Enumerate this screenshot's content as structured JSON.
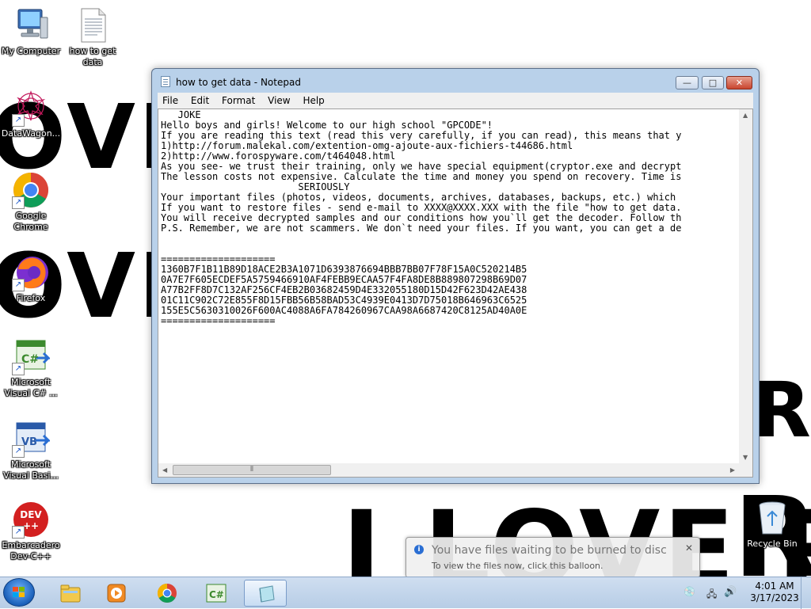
{
  "desktop": {
    "wallpaper_words": [
      "OVE",
      "OVE",
      "I LOVE R",
      "RA",
      "R"
    ],
    "icons": [
      {
        "label": "My Computer"
      },
      {
        "label": "how to get data"
      },
      {
        "label": "DataWagon..."
      },
      {
        "label": "Google Chrome"
      },
      {
        "label": "Firefox"
      },
      {
        "label": "Microsoft Visual C# ..."
      },
      {
        "label": "Microsoft Visual Basi..."
      },
      {
        "label": "Embarcadero Dev-C++"
      },
      {
        "label": "Recycle Bin"
      }
    ],
    "badges": {
      "vcs": "C#",
      "vb": "VB",
      "dev": "DEV",
      "devpp": "++"
    }
  },
  "notepad": {
    "title": "how to get data - Notepad",
    "menu": [
      "File",
      "Edit",
      "Format",
      "View",
      "Help"
    ],
    "caption": {
      "minimize": "—",
      "maximize": "□",
      "close": "✕"
    },
    "content": "   JOKE\nHello boys and girls! Welcome to our high school \"GPCODE\"!\nIf you are reading this text (read this very carefully, if you can read), this means that y\n1)http://forum.malekal.com/extention-omg-ajoute-aux-fichiers-t44686.html\n2)http://www.forospyware.com/t464048.html\nAs you see- we trust their training, only we have special equipment(cryptor.exe and decrypt\nThe lesson costs not expensive. Calculate the time and money you spend on recovery. Time is\n                        SERIOUSLY\nYour important files (photos, videos, documents, archives, databases, backups, etc.) which \nIf you want to restore files - send e-mail to XXXX@XXXX.XXX with the file \"how to get data.\nYou will receive decrypted samples and our conditions how you`ll get the decoder. Follow th\nP.S. Remember, we are not scammers. We don`t need your files. If you want, you can get a de\n\n\n====================\n1360B7F1B11B89D18ACE2B3A1071D6393876694BBB7BB07F78F15A0C520214B5\n0A7E7F605ECDEF5A5759466910AF4FEBB9ECAA57F4FA8DE8B889807298B69D07\nA77B2FF8D7C132AF256CF4EB2B03682459D4E332055180D15D42F623D42AE438\n01C11C902C72E855F8D15FBB56B58BAD53C4939E0413D7D75018B646963C6525\n155E5C5630310026F600AC4088A6FA784260967CAA98A6687420C8125AD40A0E\n===================="
  },
  "balloon": {
    "title": "You have files waiting to be burned to disc",
    "text": "To view the files now, click this balloon.",
    "close": "✕",
    "info": "i"
  },
  "taskbar": {
    "buttons": [
      "Start",
      "Windows Explorer",
      "Windows Media Player",
      "Google Chrome",
      "Visual C#",
      "Notepad"
    ],
    "cs_label": "C#",
    "clock_time": "4:01 AM",
    "clock_date": "3/17/2023"
  }
}
